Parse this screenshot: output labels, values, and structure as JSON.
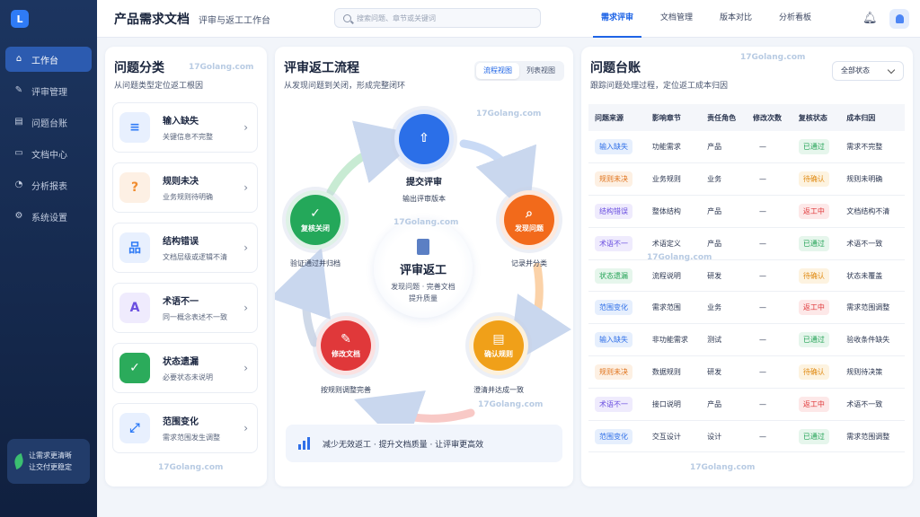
{
  "sidebar": {
    "logo": "L",
    "items": [
      {
        "label": "工作台",
        "icon": "home-icon",
        "glyph": "⌂"
      },
      {
        "label": "评审管理",
        "icon": "edit-doc-icon",
        "glyph": "✎"
      },
      {
        "label": "问题台账",
        "icon": "ledger-icon",
        "glyph": "▤"
      },
      {
        "label": "文档中心",
        "icon": "document-icon",
        "glyph": "▭"
      },
      {
        "label": "分析报表",
        "icon": "chart-icon",
        "glyph": "◔"
      },
      {
        "label": "系统设置",
        "icon": "gear-icon",
        "glyph": "⚙"
      }
    ],
    "promo_line1": "让需求更清晰",
    "promo_line2": "让交付更稳定"
  },
  "header": {
    "title": "产品需求文档",
    "subtitle": "评审与返工工作台",
    "search_placeholder": "搜索问题、章节或关键词",
    "tabs": [
      "需求评审",
      "文档管理",
      "版本对比",
      "分析看板"
    ]
  },
  "left": {
    "title": "问题分类",
    "subtitle": "从问题类型定位返工根因",
    "categories": [
      {
        "name": "输入缺失",
        "desc": "关键信息不完整",
        "icon": "document-list-icon",
        "glyph": "≡",
        "color": "#2f7bf6",
        "bg": "#e8f0fe"
      },
      {
        "name": "规则未决",
        "desc": "业务规则待明确",
        "icon": "question-icon",
        "glyph": "?",
        "color": "#f08c2e",
        "bg": "#fdf0e4"
      },
      {
        "name": "结构错误",
        "desc": "文档层级或逻辑不清",
        "icon": "hierarchy-icon",
        "glyph": "品",
        "color": "#2f7bf6",
        "bg": "#e8f0fe"
      },
      {
        "name": "术语不一",
        "desc": "同一概念表述不一致",
        "icon": "letter-a-icon",
        "glyph": "A",
        "color": "#6a4fe0",
        "bg": "#efebfd"
      },
      {
        "name": "状态遗漏",
        "desc": "必要状态未说明",
        "icon": "checkbox-icon",
        "glyph": "✓",
        "color": "#ffffff",
        "bg": "#2bab5b"
      },
      {
        "name": "范围变化",
        "desc": "需求范围发生调整",
        "icon": "expand-icon",
        "glyph": "⤢",
        "color": "#2f7bf6",
        "bg": "#e8f0fe"
      }
    ]
  },
  "middle": {
    "title": "评审返工流程",
    "subtitle": "从发现问题到关闭，形成完整闭环",
    "views": [
      "流程视图",
      "列表视图"
    ],
    "nodes": [
      {
        "name": "提交评审",
        "caption": "输出评审版本",
        "icon": "upload-doc-icon",
        "glyph": "⇧",
        "color": "#2b6fe8"
      },
      {
        "name": "发现问题",
        "caption": "记录并分类",
        "icon": "search-icon",
        "glyph": "⌕",
        "color": "#f26a1b"
      },
      {
        "name": "确认规则",
        "caption": "澄清并达成一致",
        "icon": "doc-confirm-icon",
        "glyph": "▤",
        "color": "#f0a019"
      },
      {
        "name": "修改文档",
        "caption": "按规则调整完善",
        "icon": "pencil-icon",
        "glyph": "✎",
        "color": "#e0383a"
      },
      {
        "name": "复核关闭",
        "caption": "验证通过并归档",
        "icon": "check-circle-icon",
        "glyph": "✓",
        "color": "#24a85a"
      }
    ],
    "center_title": "评审返工",
    "center_sub1": "发现问题 · 完善文档",
    "center_sub2": "提升质量",
    "banner": "减少无效返工 · 提升文档质量 · 让评审更高效"
  },
  "right": {
    "title": "问题台账",
    "subtitle": "跟踪问题处理过程，定位返工成本归因",
    "filter": "全部状态",
    "columns": [
      "问题来源",
      "影响章节",
      "责任角色",
      "修改次数",
      "复核状态",
      "成本归因"
    ],
    "rows": [
      {
        "source": "输入缺失",
        "chapter": "功能需求",
        "role": "产品",
        "count": "—",
        "status": "已通过",
        "cause": "需求不完整"
      },
      {
        "source": "规则未决",
        "chapter": "业务规则",
        "role": "业务",
        "count": "—",
        "status": "待确认",
        "cause": "规则未明确"
      },
      {
        "source": "结构错误",
        "chapter": "整体结构",
        "role": "产品",
        "count": "—",
        "status": "返工中",
        "cause": "文档结构不清"
      },
      {
        "source": "术语不一",
        "chapter": "术语定义",
        "role": "产品",
        "count": "—",
        "status": "已通过",
        "cause": "术语不一致"
      },
      {
        "source": "状态遗漏",
        "chapter": "流程说明",
        "role": "研发",
        "count": "—",
        "status": "待确认",
        "cause": "状态未覆盖"
      },
      {
        "source": "范围变化",
        "chapter": "需求范围",
        "role": "业务",
        "count": "—",
        "status": "返工中",
        "cause": "需求范围调整"
      },
      {
        "source": "输入缺失",
        "chapter": "非功能需求",
        "role": "测试",
        "count": "—",
        "status": "已通过",
        "cause": "验收条件缺失"
      },
      {
        "source": "规则未决",
        "chapter": "数据规则",
        "role": "研发",
        "count": "—",
        "status": "待确认",
        "cause": "规则待决策"
      },
      {
        "source": "术语不一",
        "chapter": "接口说明",
        "role": "产品",
        "count": "—",
        "status": "返工中",
        "cause": "术语不一致"
      },
      {
        "source": "范围变化",
        "chapter": "交互设计",
        "role": "设计",
        "count": "—",
        "status": "已通过",
        "cause": "需求范围调整"
      }
    ],
    "source_colors": {
      "输入缺失": {
        "fg": "#2f6fe8",
        "bg": "#e6effd"
      },
      "规则未决": {
        "fg": "#e0731c",
        "bg": "#fdf0e3"
      },
      "结构错误": {
        "fg": "#6a4fe0",
        "bg": "#efebfd"
      },
      "术语不一": {
        "fg": "#6a4fe0",
        "bg": "#efebfd"
      },
      "状态遗漏": {
        "fg": "#22a255",
        "bg": "#e6f6ec"
      },
      "范围变化": {
        "fg": "#2f6fe8",
        "bg": "#e6effd"
      }
    },
    "status_colors": {
      "已通过": {
        "fg": "#22a255",
        "bg": "#e6f6ec"
      },
      "待确认": {
        "fg": "#e08a12",
        "bg": "#fdf3e0"
      },
      "返工中": {
        "fg": "#e0383a",
        "bg": "#fde8e8"
      }
    }
  },
  "watermark": "17Golang.com"
}
